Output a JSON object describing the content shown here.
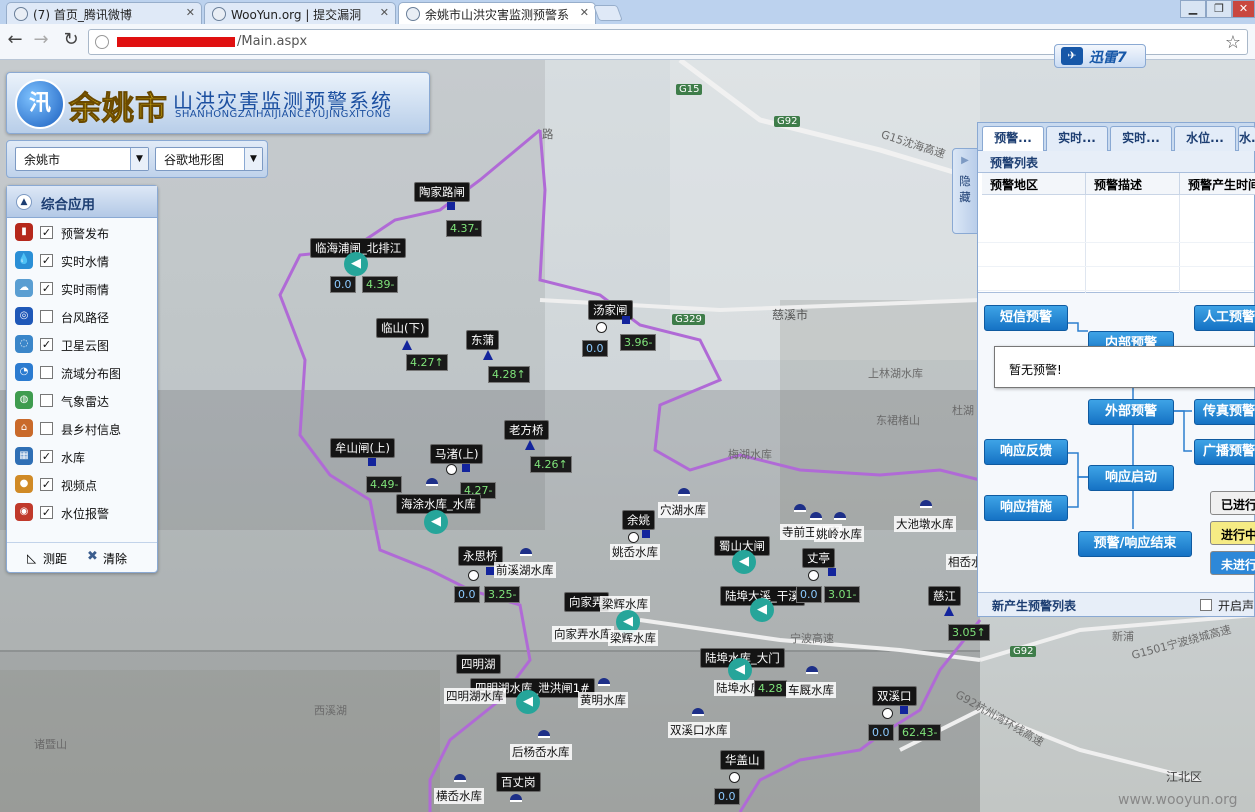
{
  "browser": {
    "tabs": [
      {
        "title": "(7) 首页_腾讯微博"
      },
      {
        "title": "WooYun.org | 提交漏洞"
      },
      {
        "title": "余姚市山洪灾害监测预警系"
      }
    ],
    "url_suffix": "/Main.aspx",
    "xunlei_label": "迅雷7"
  },
  "app": {
    "logo_city": "余姚市",
    "logo_title": "山洪灾害监测预警系统",
    "logo_pinyin": "SHANHONGZAIHAIJIANCEYUJINGXITONG",
    "logo_char": "汛",
    "region_select": "余姚市",
    "maptype_select": "谷歌地形图"
  },
  "panel": {
    "title": "综合应用",
    "items": [
      {
        "label": "预警发布",
        "checked": true,
        "icon": "traffic-light-icon"
      },
      {
        "label": "实时水情",
        "checked": true,
        "icon": "water-drop-icon"
      },
      {
        "label": "实时雨情",
        "checked": true,
        "icon": "rain-cloud-icon"
      },
      {
        "label": "台风路径",
        "checked": false,
        "icon": "typhoon-icon"
      },
      {
        "label": "卫星云图",
        "checked": true,
        "icon": "satellite-icon"
      },
      {
        "label": "流域分布图",
        "checked": false,
        "icon": "basin-icon"
      },
      {
        "label": "气象雷达",
        "checked": false,
        "icon": "radar-icon"
      },
      {
        "label": "县乡村信息",
        "checked": false,
        "icon": "house-icon"
      },
      {
        "label": "水库",
        "checked": true,
        "icon": "reservoir-icon"
      },
      {
        "label": "视频点",
        "checked": true,
        "icon": "camera-icon"
      },
      {
        "label": "水位报警",
        "checked": true,
        "icon": "target-icon"
      }
    ],
    "measure_label": "测距",
    "clear_label": "清除",
    "check_mark": "✓"
  },
  "warning": {
    "hide_label": "隐藏",
    "tabs": [
      "预警...",
      "实时...",
      "实时...",
      "水位...",
      "水..."
    ],
    "subtitle": "预警列表",
    "columns": [
      "预警地区",
      "预警描述",
      "预警产生时间"
    ],
    "popup": "暂无预警!",
    "flow": {
      "sms": "短信预警",
      "internal": "内部预警",
      "manual": "人工预警",
      "external": "外部预警",
      "fax": "传真预警",
      "broadcast": "广播预警",
      "feedback": "响应反馈",
      "start": "响应启动",
      "measures": "响应措施",
      "end": "预警/响应结束"
    },
    "legend": {
      "done": "已进行",
      "doing": "进行中",
      "notdone": "未进行"
    },
    "footer": "新产生预警列表",
    "sound_label": "开启声"
  },
  "map": {
    "labels": {
      "cixi": "慈溪市",
      "shanglinhu": "上林湖水库",
      "dongjiazhu": "东裙楮山",
      "meixi": "梅湖水库",
      "duqiao": "杜湖",
      "xinpu": "新浦",
      "xishan": "西溪湖",
      "jiangbei": "江北区",
      "zhuchan": "诸暨山",
      "xixi": "西溪湖",
      "road_lin": "G15沈海高速",
      "road_g1501": "G1501宁波绕城高速",
      "road_ningbo": "宁波高速",
      "road_hz": "G92杭州湾环线高速",
      "g15": "G15",
      "g92a": "G92",
      "g92b": "G92",
      "g329": "G329"
    },
    "stations": [
      "陶家路闸",
      "临海浦闸_北排江",
      "临山(下)",
      "东蒲",
      "汤家闸",
      "老方桥",
      "牟山闸(上)",
      "马渚(上)",
      "海涂水库_水库",
      "余姚",
      "姚岙水库",
      "穴湖水库",
      "永思桥",
      "前溪湖水库",
      "向家弄",
      "梁辉水库",
      "向家弄水库",
      "梁辉水库",
      "蜀山大闸",
      "陆埠大溪_干溪",
      "丈亭",
      "寺前王水库",
      "姚岭水库",
      "大池墩水库",
      "相岙水库",
      "慈江",
      "四明湖",
      "四明湖水库_泄洪闸1#",
      "四明湖水库",
      "黄明水库",
      "陆埠水库_大门",
      "陆埠水库",
      "车厩水库",
      "双溪口",
      "双溪口水库",
      "后杨岙水库",
      "华盖山",
      "百丈岗",
      "横岙水库",
      "路"
    ],
    "values": [
      "4.37-",
      "0.0",
      "4.39-",
      "4.27↑",
      "4.28↑",
      "0.0",
      "3.96-",
      "4.26↑",
      "4.49-",
      "4.27-",
      "0.0",
      "3.25-",
      "0.0",
      "3.01-",
      "3.05↑",
      "0.0",
      "62.43-",
      "0.0",
      "4.28",
      "0.0"
    ]
  }
}
